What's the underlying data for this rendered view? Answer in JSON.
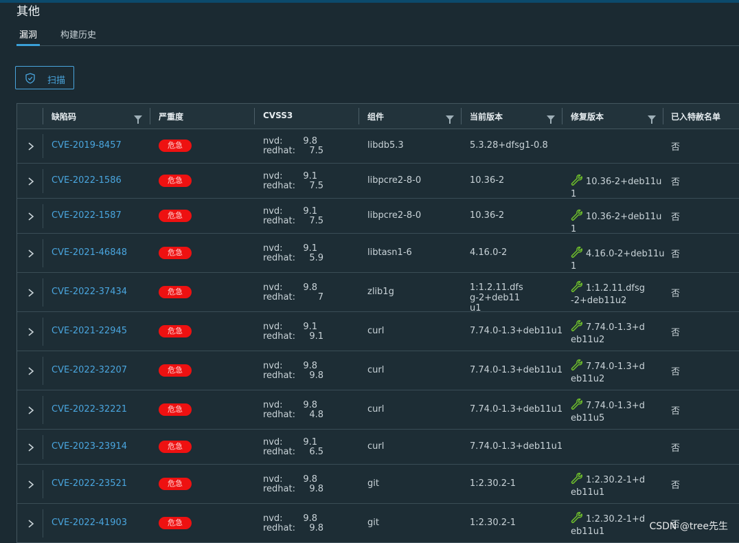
{
  "page": {
    "title": "其他"
  },
  "tabs": [
    {
      "label": "漏洞",
      "active": true
    },
    {
      "label": "构建历史",
      "active": false
    }
  ],
  "toolbar": {
    "scan_label": "扫描",
    "icon": "shield-check-icon"
  },
  "table": {
    "columns": [
      "缺陷码",
      "严重度",
      "CVSS3",
      "组件",
      "当前版本",
      "修复版本",
      "已入特赦名单"
    ],
    "cvss_labels": {
      "nvd": "nvd:",
      "redhat": "redhat:"
    },
    "rows": [
      {
        "cve": "CVE-2019-8457",
        "severity": "危急",
        "nvd": "9.8",
        "redhat": "7.5",
        "component": "libdb5.3",
        "current": "5.3.28+dfsg1-0.8",
        "fix": "",
        "whitelisted": "否"
      },
      {
        "cve": "CVE-2022-1586",
        "severity": "危急",
        "nvd": "9.1",
        "redhat": "7.5",
        "component": "libpcre2-8-0",
        "current": "10.36-2",
        "fix": "10.36-2+deb11u1",
        "whitelisted": "否"
      },
      {
        "cve": "CVE-2022-1587",
        "severity": "危急",
        "nvd": "9.1",
        "redhat": "7.5",
        "component": "libpcre2-8-0",
        "current": "10.36-2",
        "fix": "10.36-2+deb11u1",
        "whitelisted": "否"
      },
      {
        "cve": "CVE-2021-46848",
        "severity": "危急",
        "nvd": "9.1",
        "redhat": "5.9",
        "component": "libtasn1-6",
        "current": "4.16.0-2",
        "fix": "4.16.0-2+deb11u1",
        "whitelisted": "否"
      },
      {
        "cve": "CVE-2022-37434",
        "severity": "危急",
        "nvd": "9.8",
        "redhat": "7",
        "component": "zlib1g",
        "current": "1:1.2.11.dfsg-2+deb11u1",
        "fix": "1:1.2.11.dfsg-2+deb11u2",
        "whitelisted": "否"
      },
      {
        "cve": "CVE-2021-22945",
        "severity": "危急",
        "nvd": "9.1",
        "redhat": "9.1",
        "component": "curl",
        "current": "7.74.0-1.3+deb11u1",
        "fix": "7.74.0-1.3+deb11u2",
        "whitelisted": "否"
      },
      {
        "cve": "CVE-2022-32207",
        "severity": "危急",
        "nvd": "9.8",
        "redhat": "9.8",
        "component": "curl",
        "current": "7.74.0-1.3+deb11u1",
        "fix": "7.74.0-1.3+deb11u2",
        "whitelisted": "否"
      },
      {
        "cve": "CVE-2022-32221",
        "severity": "危急",
        "nvd": "9.8",
        "redhat": "4.8",
        "component": "curl",
        "current": "7.74.0-1.3+deb11u1",
        "fix": "7.74.0-1.3+deb11u5",
        "whitelisted": "否"
      },
      {
        "cve": "CVE-2023-23914",
        "severity": "危急",
        "nvd": "9.1",
        "redhat": "6.5",
        "component": "curl",
        "current": "7.74.0-1.3+deb11u1",
        "fix": "",
        "whitelisted": "否"
      },
      {
        "cve": "CVE-2022-23521",
        "severity": "危急",
        "nvd": "9.8",
        "redhat": "9.8",
        "component": "git",
        "current": "1:2.30.2-1",
        "fix": "1:2.30.2-1+deb11u1",
        "whitelisted": "否"
      },
      {
        "cve": "CVE-2022-41903",
        "severity": "危急",
        "nvd": "9.8",
        "redhat": "9.8",
        "component": "git",
        "current": "1:2.30.2-1",
        "fix": "1:2.30.2-1+deb11u1",
        "whitelisted": "否"
      }
    ]
  },
  "watermark": "CSDN @tree先生",
  "colors": {
    "link": "#4aa6df",
    "critical": "#ee1111",
    "wrench": "#6fbf2c",
    "background": "#1b2a32"
  }
}
